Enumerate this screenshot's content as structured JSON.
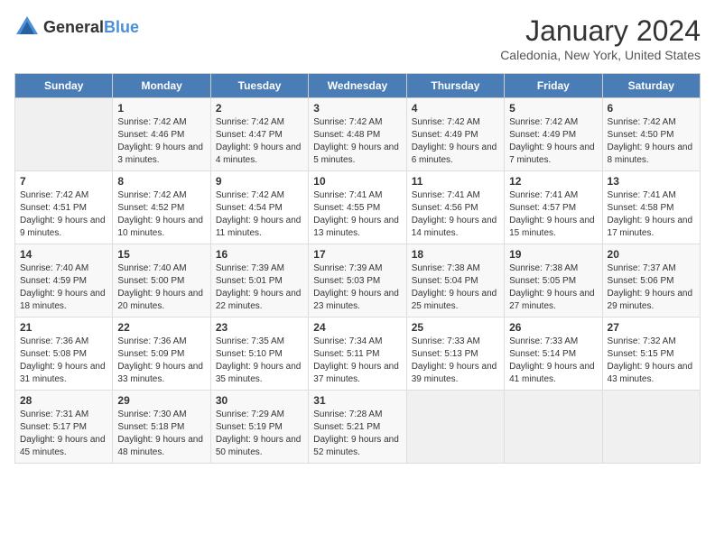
{
  "logo": {
    "general": "General",
    "blue": "Blue"
  },
  "header": {
    "month": "January 2024",
    "location": "Caledonia, New York, United States"
  },
  "days_of_week": [
    "Sunday",
    "Monday",
    "Tuesday",
    "Wednesday",
    "Thursday",
    "Friday",
    "Saturday"
  ],
  "weeks": [
    [
      {
        "day": "",
        "sunrise": "",
        "sunset": "",
        "daylight": "",
        "empty": true
      },
      {
        "day": "1",
        "sunrise": "Sunrise: 7:42 AM",
        "sunset": "Sunset: 4:46 PM",
        "daylight": "Daylight: 9 hours and 3 minutes."
      },
      {
        "day": "2",
        "sunrise": "Sunrise: 7:42 AM",
        "sunset": "Sunset: 4:47 PM",
        "daylight": "Daylight: 9 hours and 4 minutes."
      },
      {
        "day": "3",
        "sunrise": "Sunrise: 7:42 AM",
        "sunset": "Sunset: 4:48 PM",
        "daylight": "Daylight: 9 hours and 5 minutes."
      },
      {
        "day": "4",
        "sunrise": "Sunrise: 7:42 AM",
        "sunset": "Sunset: 4:49 PM",
        "daylight": "Daylight: 9 hours and 6 minutes."
      },
      {
        "day": "5",
        "sunrise": "Sunrise: 7:42 AM",
        "sunset": "Sunset: 4:49 PM",
        "daylight": "Daylight: 9 hours and 7 minutes."
      },
      {
        "day": "6",
        "sunrise": "Sunrise: 7:42 AM",
        "sunset": "Sunset: 4:50 PM",
        "daylight": "Daylight: 9 hours and 8 minutes."
      }
    ],
    [
      {
        "day": "7",
        "sunrise": "Sunrise: 7:42 AM",
        "sunset": "Sunset: 4:51 PM",
        "daylight": "Daylight: 9 hours and 9 minutes."
      },
      {
        "day": "8",
        "sunrise": "Sunrise: 7:42 AM",
        "sunset": "Sunset: 4:52 PM",
        "daylight": "Daylight: 9 hours and 10 minutes."
      },
      {
        "day": "9",
        "sunrise": "Sunrise: 7:42 AM",
        "sunset": "Sunset: 4:54 PM",
        "daylight": "Daylight: 9 hours and 11 minutes."
      },
      {
        "day": "10",
        "sunrise": "Sunrise: 7:41 AM",
        "sunset": "Sunset: 4:55 PM",
        "daylight": "Daylight: 9 hours and 13 minutes."
      },
      {
        "day": "11",
        "sunrise": "Sunrise: 7:41 AM",
        "sunset": "Sunset: 4:56 PM",
        "daylight": "Daylight: 9 hours and 14 minutes."
      },
      {
        "day": "12",
        "sunrise": "Sunrise: 7:41 AM",
        "sunset": "Sunset: 4:57 PM",
        "daylight": "Daylight: 9 hours and 15 minutes."
      },
      {
        "day": "13",
        "sunrise": "Sunrise: 7:41 AM",
        "sunset": "Sunset: 4:58 PM",
        "daylight": "Daylight: 9 hours and 17 minutes."
      }
    ],
    [
      {
        "day": "14",
        "sunrise": "Sunrise: 7:40 AM",
        "sunset": "Sunset: 4:59 PM",
        "daylight": "Daylight: 9 hours and 18 minutes."
      },
      {
        "day": "15",
        "sunrise": "Sunrise: 7:40 AM",
        "sunset": "Sunset: 5:00 PM",
        "daylight": "Daylight: 9 hours and 20 minutes."
      },
      {
        "day": "16",
        "sunrise": "Sunrise: 7:39 AM",
        "sunset": "Sunset: 5:01 PM",
        "daylight": "Daylight: 9 hours and 22 minutes."
      },
      {
        "day": "17",
        "sunrise": "Sunrise: 7:39 AM",
        "sunset": "Sunset: 5:03 PM",
        "daylight": "Daylight: 9 hours and 23 minutes."
      },
      {
        "day": "18",
        "sunrise": "Sunrise: 7:38 AM",
        "sunset": "Sunset: 5:04 PM",
        "daylight": "Daylight: 9 hours and 25 minutes."
      },
      {
        "day": "19",
        "sunrise": "Sunrise: 7:38 AM",
        "sunset": "Sunset: 5:05 PM",
        "daylight": "Daylight: 9 hours and 27 minutes."
      },
      {
        "day": "20",
        "sunrise": "Sunrise: 7:37 AM",
        "sunset": "Sunset: 5:06 PM",
        "daylight": "Daylight: 9 hours and 29 minutes."
      }
    ],
    [
      {
        "day": "21",
        "sunrise": "Sunrise: 7:36 AM",
        "sunset": "Sunset: 5:08 PM",
        "daylight": "Daylight: 9 hours and 31 minutes."
      },
      {
        "day": "22",
        "sunrise": "Sunrise: 7:36 AM",
        "sunset": "Sunset: 5:09 PM",
        "daylight": "Daylight: 9 hours and 33 minutes."
      },
      {
        "day": "23",
        "sunrise": "Sunrise: 7:35 AM",
        "sunset": "Sunset: 5:10 PM",
        "daylight": "Daylight: 9 hours and 35 minutes."
      },
      {
        "day": "24",
        "sunrise": "Sunrise: 7:34 AM",
        "sunset": "Sunset: 5:11 PM",
        "daylight": "Daylight: 9 hours and 37 minutes."
      },
      {
        "day": "25",
        "sunrise": "Sunrise: 7:33 AM",
        "sunset": "Sunset: 5:13 PM",
        "daylight": "Daylight: 9 hours and 39 minutes."
      },
      {
        "day": "26",
        "sunrise": "Sunrise: 7:33 AM",
        "sunset": "Sunset: 5:14 PM",
        "daylight": "Daylight: 9 hours and 41 minutes."
      },
      {
        "day": "27",
        "sunrise": "Sunrise: 7:32 AM",
        "sunset": "Sunset: 5:15 PM",
        "daylight": "Daylight: 9 hours and 43 minutes."
      }
    ],
    [
      {
        "day": "28",
        "sunrise": "Sunrise: 7:31 AM",
        "sunset": "Sunset: 5:17 PM",
        "daylight": "Daylight: 9 hours and 45 minutes."
      },
      {
        "day": "29",
        "sunrise": "Sunrise: 7:30 AM",
        "sunset": "Sunset: 5:18 PM",
        "daylight": "Daylight: 9 hours and 48 minutes."
      },
      {
        "day": "30",
        "sunrise": "Sunrise: 7:29 AM",
        "sunset": "Sunset: 5:19 PM",
        "daylight": "Daylight: 9 hours and 50 minutes."
      },
      {
        "day": "31",
        "sunrise": "Sunrise: 7:28 AM",
        "sunset": "Sunset: 5:21 PM",
        "daylight": "Daylight: 9 hours and 52 minutes."
      },
      {
        "day": "",
        "sunrise": "",
        "sunset": "",
        "daylight": "",
        "empty": true
      },
      {
        "day": "",
        "sunrise": "",
        "sunset": "",
        "daylight": "",
        "empty": true
      },
      {
        "day": "",
        "sunrise": "",
        "sunset": "",
        "daylight": "",
        "empty": true
      }
    ]
  ]
}
